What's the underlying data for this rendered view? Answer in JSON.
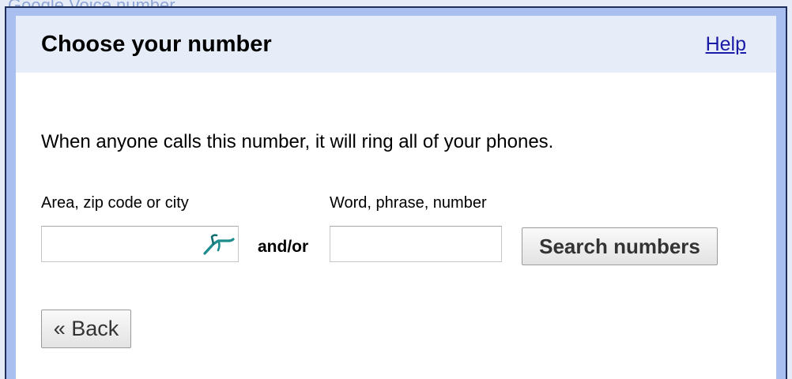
{
  "background": {
    "title": "Google Voice number"
  },
  "dialog": {
    "title": "Choose your number",
    "help_label": "Help",
    "description": "When anyone calls this number, it will ring all of your phones.",
    "area_field": {
      "label": "Area, zip code or city",
      "value": "",
      "placeholder": ""
    },
    "connector": "and/or",
    "word_field": {
      "label": "Word, phrase, number",
      "value": "",
      "placeholder": ""
    },
    "search_label": "Search numbers",
    "back_label": "« Back"
  },
  "icons": {
    "location_icon": "map-pin-icon",
    "location_icon_color": "#1e8c8c"
  },
  "colors": {
    "frame": "#a9bff0",
    "header_bg": "#e6edf8",
    "link": "#1a1aa6"
  }
}
